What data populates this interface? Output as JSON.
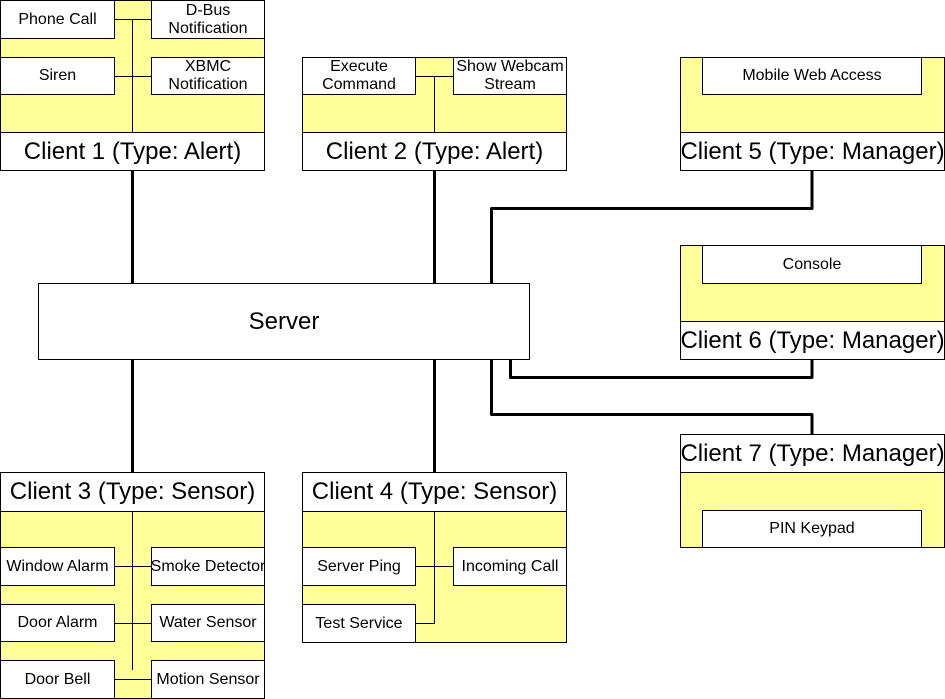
{
  "server": {
    "label": "Server"
  },
  "clients": {
    "c1": {
      "title": "Client 1 (Type: Alert)",
      "modules": [
        "Phone Call",
        "D-Bus\nNotification",
        "Siren",
        "XBMC\nNotification"
      ]
    },
    "c2": {
      "title": "Client 2 (Type: Alert)",
      "modules": [
        "Execute\nCommand",
        "Show Webcam\nStream"
      ]
    },
    "c3": {
      "title": "Client 3 (Type: Sensor)",
      "modules": [
        "Window Alarm",
        "Smoke Detector",
        "Door Alarm",
        "Water Sensor",
        "Door Bell",
        "Motion Sensor"
      ]
    },
    "c4": {
      "title": "Client 4 (Type: Sensor)",
      "modules": [
        "Server Ping",
        "Incoming Call",
        "Test Service"
      ]
    },
    "c5": {
      "title": "Client 5 (Type: Manager)",
      "modules": [
        "Mobile Web Access"
      ]
    },
    "c6": {
      "title": "Client 6 (Type: Manager)",
      "modules": [
        "Console"
      ]
    },
    "c7": {
      "title": "Client 7 (Type: Manager)",
      "modules": [
        "PIN Keypad"
      ]
    }
  },
  "colors": {
    "panel": "#ffff99",
    "box": "#ffffff",
    "line": "#000000"
  }
}
